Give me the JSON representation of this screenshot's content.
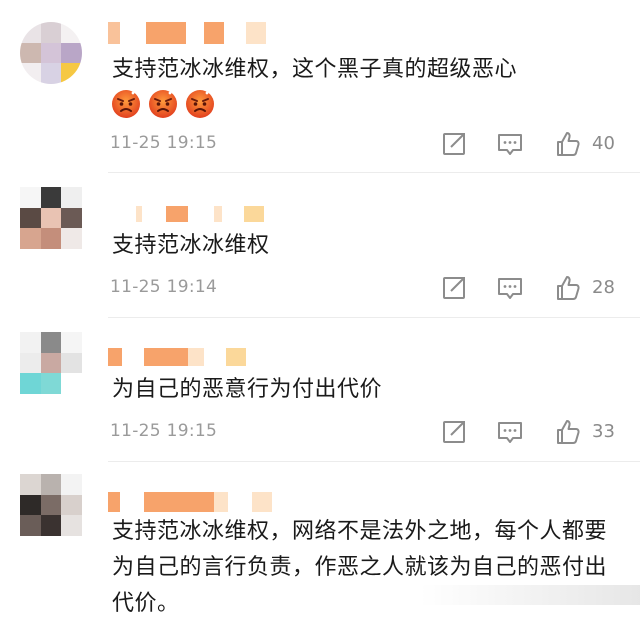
{
  "comments": [
    {
      "text": "支持范冰冰维权，这个黑子真的超级恶心",
      "emojis": [
        "angry-face-icon",
        "angry-face-icon",
        "angry-face-icon"
      ],
      "time": "11-25 19:15",
      "likes": "40"
    },
    {
      "text": "支持范冰冰维权",
      "time": "11-25 19:14",
      "likes": "28"
    },
    {
      "text": "为自己的恶意行为付出代价",
      "time": "11-25 19:15",
      "likes": "33"
    },
    {
      "text": "支持范冰冰维权，网络不是法外之地，每个人都要为自己的言行负责，作恶之人就该为自己的恶付出代价。"
    }
  ],
  "colors": {
    "name_orange": "#f7a36b",
    "name_light": "#fde3c8",
    "name_yellow": "#fbd89a",
    "icon_gray": "#8c8c8c",
    "text": "#1a1a1a",
    "time": "#9a9a9a"
  }
}
